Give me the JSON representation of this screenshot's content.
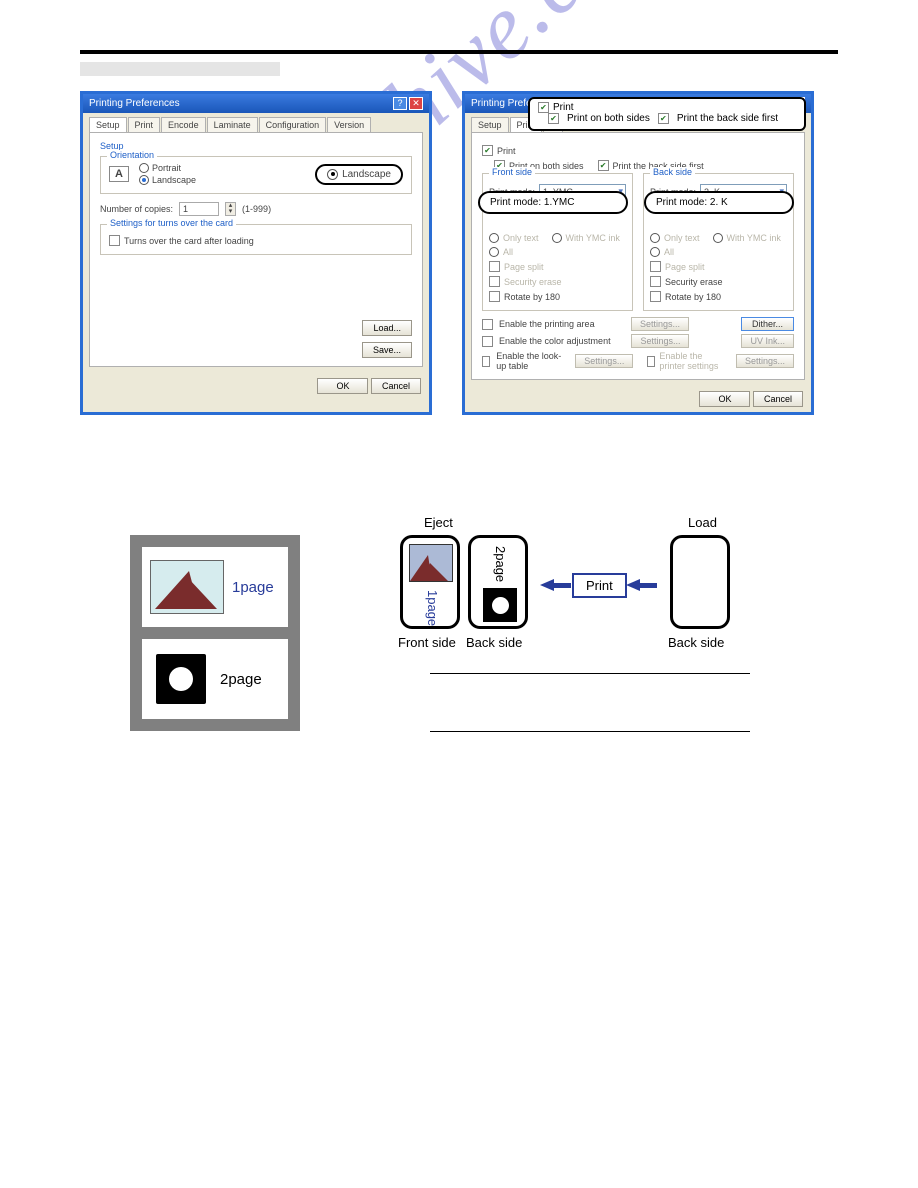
{
  "watermark": "manualshive.com",
  "dialogs": {
    "title": "Printing Preferences",
    "tabs": [
      "Setup",
      "Print",
      "Encode",
      "Laminate",
      "Configuration",
      "Version"
    ],
    "setup": {
      "section": "Setup",
      "orientation_label": "Orientation",
      "icon_letter": "A",
      "opt_portrait": "Portrait",
      "opt_landscape": "Landscape",
      "pill_landscape": "Landscape",
      "copies_label": "Number of copies:",
      "copies_value": "1",
      "copies_hint": "(1-999)",
      "turns_section": "Settings for turns over the card",
      "turns_chk": "Turns over the card after loading",
      "btn_load": "Load...",
      "btn_save": "Save..."
    },
    "print": {
      "chk_print": "Print",
      "chk_both": "Print on both sides",
      "chk_backfirst": "Print the back side first",
      "front": "Front side",
      "back": "Back side",
      "pm_label": "Print mode:",
      "pm_front": "1. YMC",
      "pm_back": "2. K",
      "pill_front": "Print mode:  1.YMC",
      "pill_back": "Print mode:  2. K",
      "opt_onlytext": "Only text",
      "opt_withymc": "With YMC ink",
      "opt_all": "All",
      "opt_pagesplit": "Page split",
      "opt_securityerase": "Security erase",
      "opt_rotate": "Rotate by 180",
      "opt_enable_area": "Enable the printing area",
      "opt_enable_color": "Enable the color adjustment",
      "opt_enable_lookup": "Enable the look-up table",
      "opt_enable_printer": "Enable the printer settings",
      "btn_settings": "Settings...",
      "btn_dither": "Dither...",
      "btn_uvink": "UV Ink..."
    },
    "btn_ok": "OK",
    "btn_cancel": "Cancel"
  },
  "callout_print": {
    "print": "Print",
    "both": "Print on both sides",
    "backfirst": "Print the back side first"
  },
  "example": {
    "left": {
      "page1": "1page",
      "page2": "2page"
    },
    "right": {
      "eject": "Eject",
      "load": "Load",
      "print": "Print",
      "front": "Front side",
      "back": "Back side",
      "p1": "1page",
      "p2": "2page"
    }
  }
}
